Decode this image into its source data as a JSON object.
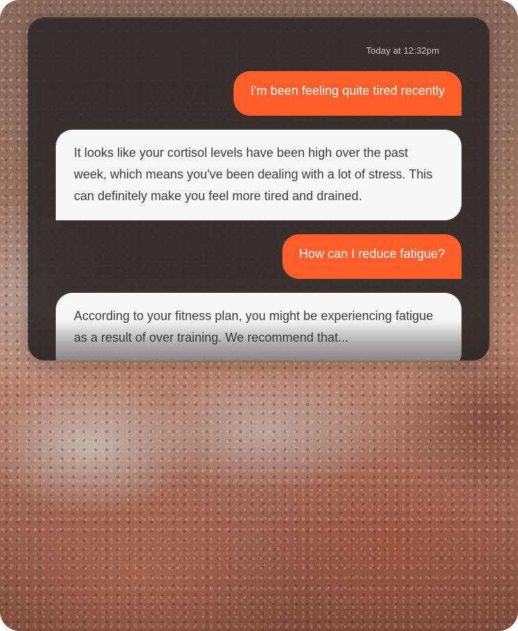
{
  "chat": {
    "timestamp": "Today at 12:32pm",
    "messages": [
      {
        "role": "user",
        "text": "I'm been feeling quite tired recently"
      },
      {
        "role": "assistant",
        "text": "It looks like your cortisol levels have been high over the past week, which means you've been dealing with a lot of stress. This can definitely make you feel more tired and drained."
      },
      {
        "role": "user",
        "text": "How can I reduce fatigue?"
      },
      {
        "role": "assistant",
        "text": "According to your fitness plan, you might be experiencing fatigue as a result of over training. We recommend that..."
      }
    ]
  },
  "colors": {
    "user_bubble": "#ff5e2b",
    "assistant_bubble": "#f7f7f7",
    "panel": "#302a28"
  }
}
